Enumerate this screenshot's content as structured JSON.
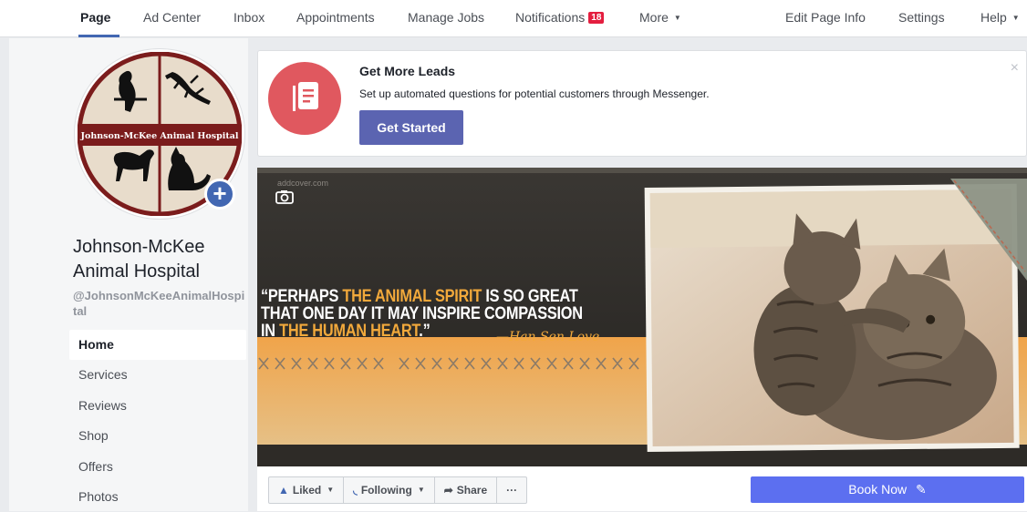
{
  "topnav": {
    "page": "Page",
    "ad_center": "Ad Center",
    "inbox": "Inbox",
    "appointments": "Appointments",
    "manage_jobs": "Manage Jobs",
    "notifications": "Notifications",
    "notifications_count": "18",
    "more": "More",
    "edit_page_info": "Edit Page Info",
    "settings": "Settings",
    "help": "Help"
  },
  "profile": {
    "logo_text": "Johnson-McKee Animal Hospital",
    "name": "Johnson-McKee Animal Hospital",
    "handle": "@JohnsonMcKeeAnimalHospital"
  },
  "sidebar": {
    "items": [
      {
        "label": "Home"
      },
      {
        "label": "Services"
      },
      {
        "label": "Reviews"
      },
      {
        "label": "Shop"
      },
      {
        "label": "Offers"
      },
      {
        "label": "Photos"
      }
    ]
  },
  "leads_card": {
    "title": "Get More Leads",
    "description": "Set up automated questions for potential customers through Messenger.",
    "button": "Get Started",
    "close": "×"
  },
  "cover": {
    "watermark": "addcover.com",
    "quote_part1": "“PERHAPS ",
    "quote_hl1": "THE ANIMAL SPIRIT",
    "quote_part2": " IS SO GREAT THAT ONE DAY IT MAY INSPIRE COMPASSION IN ",
    "quote_hl2": "THE HUMAN HEART",
    "quote_part3": ".”",
    "author": "—Han Sen Love"
  },
  "actions": {
    "liked": "Liked",
    "following": "Following",
    "share": "Share",
    "more": "···",
    "book_now": "Book Now"
  },
  "colors": {
    "accent": "#4267b2",
    "book_button": "#5c6ff0",
    "get_started": "#5b64b1",
    "leads_icon_bg": "#e0585f",
    "badge": "#e41e3f",
    "quote_highlight": "#f2a93b"
  }
}
